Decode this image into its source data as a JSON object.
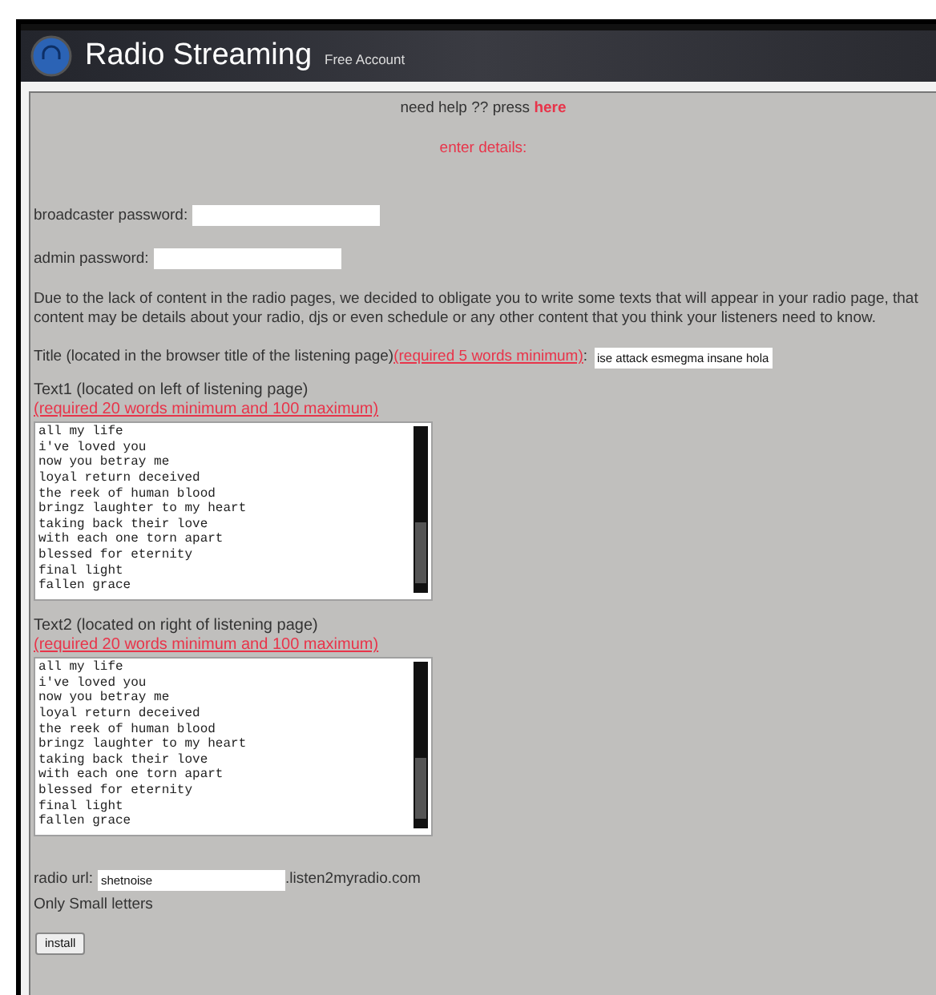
{
  "header": {
    "title": "Radio Streaming",
    "subtitle": "Free Account"
  },
  "help": {
    "text": "need help ?? press",
    "link": "here"
  },
  "section_title": "enter details:",
  "broadcaster_password": {
    "label": "broadcaster password:"
  },
  "admin_password": {
    "label": "admin password:"
  },
  "notice": "Due to the lack of content in the radio pages, we decided to obligate you to write some texts that will appear in your radio page, that content may be details about your radio, djs or even schedule or any other content that you think your listeners need to know.",
  "title_field": {
    "label": "Title (located in the browser title of the listening page)",
    "requirement": "(required 5 words minimum)",
    "separator": ":",
    "value": "ise attack esmegma insane hola"
  },
  "text_areas": [
    {
      "label": "Text1 (located on left of listening page)",
      "requirement": "(required 20 words minimum and 100 maximum)",
      "lines": [
        "all my life",
        "i've loved you",
        "now you betray me",
        "loyal return deceived",
        "the reek of human blood",
        "bringz laughter to my heart",
        "taking back their love",
        "with each one torn apart",
        "blessed for eternity",
        "final light",
        "fallen grace"
      ]
    },
    {
      "label": "Text2 (located on right of listening page)",
      "requirement": "(required 20 words minimum and 100 maximum)",
      "lines": [
        "all my life",
        "i've loved you",
        "now you betray me",
        "loyal return deceived",
        "the reek of human blood",
        "bringz laughter to my heart",
        "taking back their love",
        "with each one torn apart",
        "blessed for eternity",
        "final light",
        "fallen grace"
      ]
    }
  ],
  "radio_url": {
    "label": "radio url:",
    "value": "shetnoise",
    "suffix": ".listen2myradio.com",
    "hint": "Only Small letters"
  },
  "install_button": "install"
}
